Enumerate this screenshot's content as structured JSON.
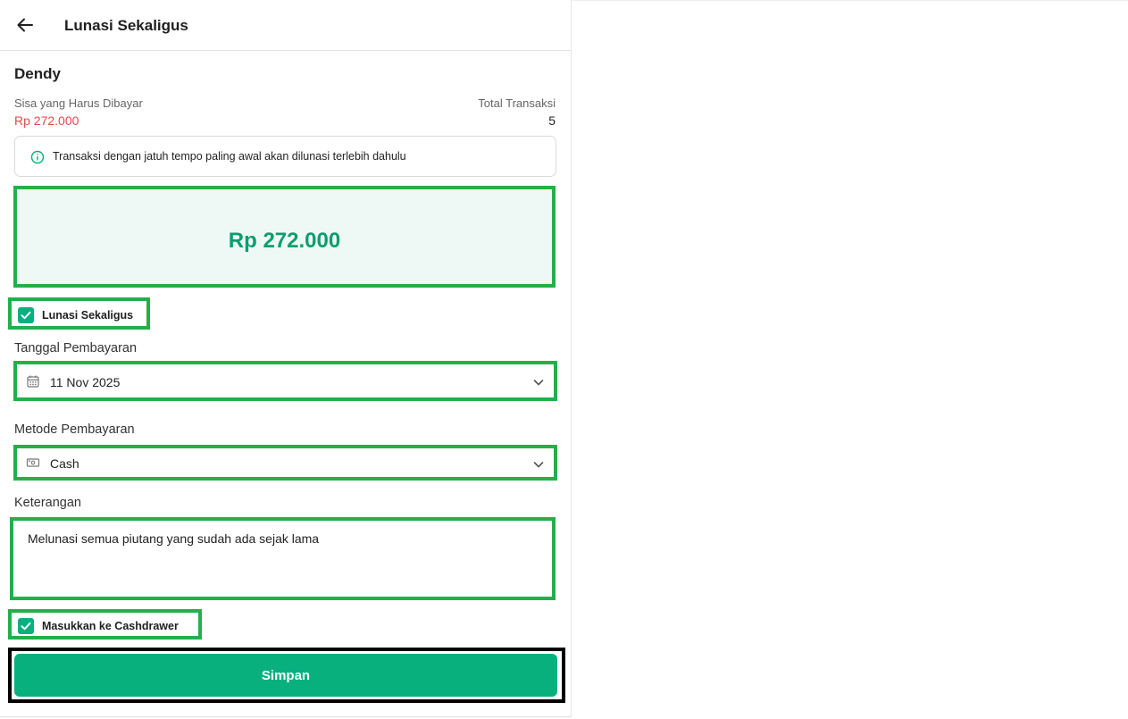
{
  "header": {
    "title": "Lunasi Sekaligus"
  },
  "customer": {
    "name": "Dendy"
  },
  "summary": {
    "sisa_label": "Sisa yang Harus Dibayar",
    "sisa_value": "Rp 272.000",
    "total_label": "Total Transaksi",
    "total_value": "5"
  },
  "info": {
    "text": "Transaksi dengan jatuh tempo paling awal akan dilunasi terlebih dahulu"
  },
  "amount": {
    "value": "Rp 272.000"
  },
  "lunasi_checkbox": {
    "label": "Lunasi Sekaligus",
    "checked": true
  },
  "payment_date": {
    "label": "Tanggal Pembayaran",
    "value": "11 Nov 2025"
  },
  "payment_method": {
    "label": "Metode Pembayaran",
    "value": "Cash"
  },
  "notes": {
    "label": "Keterangan",
    "value": "Melunasi semua piutang yang sudah ada sejak lama"
  },
  "cashdrawer_checkbox": {
    "label": "Masukkan ke Cashdrawer",
    "checked": true
  },
  "save_button": {
    "label": "Simpan"
  },
  "colors": {
    "accent": "#08b07e",
    "amount_text": "#0a9e6e",
    "amount_bg": "#eef9f5",
    "due_red": "#e5484d",
    "highlight_green": "#22b04b"
  }
}
